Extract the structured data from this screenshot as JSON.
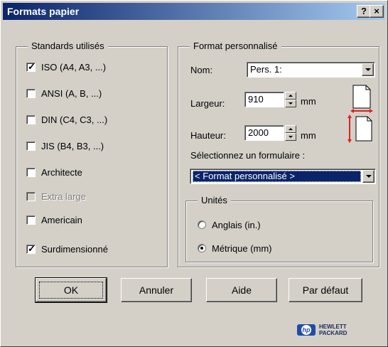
{
  "window": {
    "title": "Formats papier",
    "help_label": "?",
    "close_label": "×"
  },
  "standards": {
    "legend": "Standards utilisés",
    "items": [
      {
        "label": "ISO (A4, A3, ...)",
        "checked": true,
        "enabled": true
      },
      {
        "label": "ANSI (A, B, ...)",
        "checked": false,
        "enabled": true
      },
      {
        "label": "DIN (C4, C3, ...)",
        "checked": false,
        "enabled": true
      },
      {
        "label": "JIS (B4, B3, ...)",
        "checked": false,
        "enabled": true
      },
      {
        "label": "Architecte",
        "checked": false,
        "enabled": true
      },
      {
        "label": "Extra large",
        "checked": false,
        "enabled": false
      },
      {
        "label": "Americain",
        "checked": false,
        "enabled": true
      },
      {
        "label": "Surdimensionné",
        "checked": true,
        "enabled": true
      }
    ]
  },
  "custom": {
    "legend": "Format personnalisé",
    "name_label": "Nom:",
    "name_value": "Pers. 1:",
    "width_label": "Largeur:",
    "width_value": "910",
    "width_unit": "mm",
    "height_label": "Hauteur:",
    "height_value": "2000",
    "height_unit": "mm",
    "form_label": "Sélectionnez un formulaire :",
    "form_value": "< Format personnalisé >"
  },
  "units": {
    "legend": "Unités",
    "options": [
      {
        "label": "Anglais (in.)",
        "selected": false
      },
      {
        "label": "Métrique (mm)",
        "selected": true
      }
    ]
  },
  "buttons": {
    "ok": "OK",
    "cancel": "Annuler",
    "help": "Aide",
    "default": "Par défaut"
  },
  "brand": {
    "logo_letters": "hp",
    "line1": "HEWLETT",
    "line2": "PACKARD",
    "color": "#1f4da8"
  },
  "colors": {
    "face": "#d4d0c8",
    "title_start": "#0a246a",
    "title_end": "#a6caf0",
    "selection": "#0a246a",
    "dimension_arrow": "#e0201a"
  }
}
